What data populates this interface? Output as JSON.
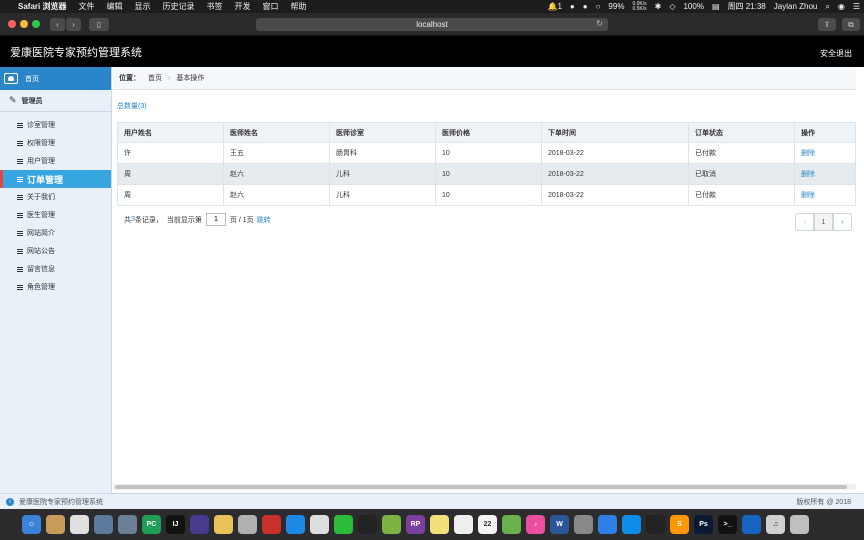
{
  "menubar": {
    "app_name": "Safari 浏览器",
    "menus": [
      "文件",
      "编辑",
      "显示",
      "历史记录",
      "书签",
      "开发",
      "窗口",
      "帮助"
    ],
    "notification_count": "1",
    "battery": "99%",
    "net_up": "0.0K/s",
    "net_down": "0.5K/s",
    "battery_level": "100%",
    "clock": "周四 21:38",
    "user": "Jaylan Zhou"
  },
  "browser": {
    "url": "localhost"
  },
  "app": {
    "title": "爱康医院专家预约管理系统",
    "logout": "安全退出"
  },
  "sidebar": {
    "home": "首页",
    "admin": "管理员",
    "items": [
      {
        "label": "诊室管理",
        "active": false
      },
      {
        "label": "权限管理",
        "active": false
      },
      {
        "label": "用户管理",
        "active": false
      },
      {
        "label": "订单管理",
        "active": true
      },
      {
        "label": "关于我们",
        "active": false
      },
      {
        "label": "医生管理",
        "active": false
      },
      {
        "label": "网站简介",
        "active": false
      },
      {
        "label": "网站公告",
        "active": false
      },
      {
        "label": "留言信息",
        "active": false
      },
      {
        "label": "角色管理",
        "active": false
      }
    ]
  },
  "breadcrumb": {
    "label": "位置：",
    "home": "首页",
    "current": "基本操作"
  },
  "total_label": "总数量(3)",
  "table": {
    "headers": [
      "用户姓名",
      "医师姓名",
      "医师诊室",
      "医师价格",
      "下单时间",
      "订单状态",
      "操作"
    ],
    "rows": [
      [
        "许",
        "王五",
        "肠胃科",
        "10",
        "2018-03-22",
        "已付款",
        "删除"
      ],
      [
        "周",
        "赵六",
        "儿科",
        "10",
        "2018-03-22",
        "已取消",
        "删除"
      ],
      [
        "周",
        "赵六",
        "儿科",
        "10",
        "2018-03-22",
        "已付款",
        "删除"
      ]
    ]
  },
  "pager": {
    "prefix": "共",
    "count": "3",
    "suffix": "条记录，",
    "current_prefix": "当前显示第",
    "page_value": "1",
    "page_suffix": "页 / 1页",
    "jump": "跳转",
    "prev": "‹",
    "page": "1",
    "next": "›"
  },
  "footer": {
    "text": "爱康医院专家预约管理系统",
    "copyright": "版权所有 @ 2018"
  },
  "dock": {
    "apps": [
      {
        "name": "finder",
        "color": "#3b82d8",
        "glyph": "☺"
      },
      {
        "name": "notes",
        "color": "#c89b5a",
        "glyph": ""
      },
      {
        "name": "photos",
        "color": "#e0e0e0",
        "glyph": ""
      },
      {
        "name": "preview",
        "color": "#5c7a9c",
        "glyph": ""
      },
      {
        "name": "launchpad",
        "color": "#6b7f95",
        "glyph": ""
      },
      {
        "name": "pycharm",
        "color": "#1f9e55",
        "glyph": "PC"
      },
      {
        "name": "intellij",
        "color": "#111",
        "glyph": "IJ"
      },
      {
        "name": "eclipse",
        "color": "#4a3a8c",
        "glyph": ""
      },
      {
        "name": "bear",
        "color": "#e8c35a",
        "glyph": ""
      },
      {
        "name": "disk",
        "color": "#b0b0b0",
        "glyph": ""
      },
      {
        "name": "redis",
        "color": "#c9302c",
        "glyph": ""
      },
      {
        "name": "safari",
        "color": "#1e88e5",
        "glyph": ""
      },
      {
        "name": "no-entry",
        "color": "#ddd",
        "glyph": ""
      },
      {
        "name": "wechat",
        "color": "#2dbb3b",
        "glyph": ""
      },
      {
        "name": "qq",
        "color": "#222",
        "glyph": ""
      },
      {
        "name": "chrome",
        "color": "#7cb342",
        "glyph": ""
      },
      {
        "name": "axure",
        "color": "#7b3fa0",
        "glyph": "RP"
      },
      {
        "name": "stickies",
        "color": "#f1e07a",
        "glyph": ""
      },
      {
        "name": "textedit",
        "color": "#eee",
        "glyph": ""
      },
      {
        "name": "calendar",
        "color": "#f4f4f4",
        "glyph": "22"
      },
      {
        "name": "maps",
        "color": "#6ab04c",
        "glyph": ""
      },
      {
        "name": "itunes",
        "color": "#e94e9f",
        "glyph": "♪"
      },
      {
        "name": "word",
        "color": "#2b579a",
        "glyph": "W"
      },
      {
        "name": "system-prefs",
        "color": "#888",
        "glyph": ""
      },
      {
        "name": "baidu-netdisk",
        "color": "#2f7fe8",
        "glyph": ""
      },
      {
        "name": "teamviewer",
        "color": "#0e8ee9",
        "glyph": ""
      },
      {
        "name": "qq2",
        "color": "#222",
        "glyph": ""
      },
      {
        "name": "sublime",
        "color": "#ff9800",
        "glyph": "S"
      },
      {
        "name": "photoshop",
        "color": "#0a1a33",
        "glyph": "Ps"
      },
      {
        "name": "terminal",
        "color": "#111",
        "glyph": ">_"
      },
      {
        "name": "quicktime",
        "color": "#1565c0",
        "glyph": ""
      },
      {
        "name": "music-doc",
        "color": "#d0d0d0",
        "glyph": "♫"
      },
      {
        "name": "trash",
        "color": "#bfbfbf",
        "glyph": ""
      }
    ]
  }
}
